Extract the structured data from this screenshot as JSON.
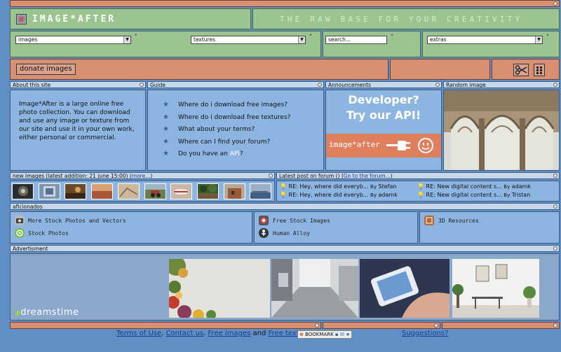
{
  "header": {
    "logo_text": "IMAGE*AFTER",
    "tagline": "THE RAW BASE FOR YOUR CREATIVITY"
  },
  "nav": {
    "images_select": "images",
    "textures_select": "textures",
    "search_placeholder": "search...",
    "extras_select": "extras",
    "donate_label": "donate images"
  },
  "about": {
    "title": "About this site",
    "text": "Image*After is a large online free photo collection. You can download and use any image or texture from our site and use it in your own work, either personal or commercial."
  },
  "guide": {
    "title": "Guide",
    "items": [
      {
        "label": "Where do i download free images?"
      },
      {
        "label": "Where do i download free textures?"
      },
      {
        "label": "What about your terms?"
      },
      {
        "label": "Where can I find your forum?"
      },
      {
        "label_prefix": "Do you have an ",
        "link": "API",
        "label_suffix": "?"
      }
    ]
  },
  "announcements": {
    "title": "Announcements",
    "line1": "Developer?",
    "line2": "Try our API!",
    "brand": "image*after"
  },
  "random_image": {
    "title": "Random image"
  },
  "new_images": {
    "title": "new images (latest addition: 21 june 15:00) (",
    "more": "more...",
    "title_end": ")"
  },
  "forum": {
    "title": "Latest post on forum () (",
    "go": "Go to the forum...",
    "title_end": ")",
    "posts": [
      {
        "subject": "RE: Hey, where did everyb...",
        "by": "By",
        "user": "Stefan"
      },
      {
        "subject": "RE: New digital content s...",
        "by": "By",
        "user": "adamk"
      },
      {
        "subject": "RE: Hey, where did everyb...",
        "by": "By",
        "user": "adamk"
      },
      {
        "subject": "RE: New digital content s...",
        "by": "By",
        "user": "Tristan"
      }
    ]
  },
  "aficionados": {
    "title": "aficionados",
    "links": [
      "More Stock Photos and Vectors",
      "Stock Photos",
      "Free Stock Images",
      "Human Alloy",
      "3D Resources"
    ]
  },
  "advertisment": {
    "title": "Advertisment",
    "brand": "dreamstime"
  },
  "footer": {
    "terms": "Terms of Use",
    "sep1": ".",
    "contact": "Contact us",
    "sep2": ".",
    "free_images": "Free images",
    "and": "and",
    "free_textures": "Free textures",
    "bookmark": "BOOKMARK",
    "suggestions": "Suggestions?"
  },
  "colors": {
    "background": "#5f8fc4",
    "green_panel": "#9bc48f",
    "salmon_panel": "#d98f72",
    "blue_panel": "#8db5e2",
    "header_strip": "#c7d8ea",
    "api_orange": "#e07f5d"
  }
}
